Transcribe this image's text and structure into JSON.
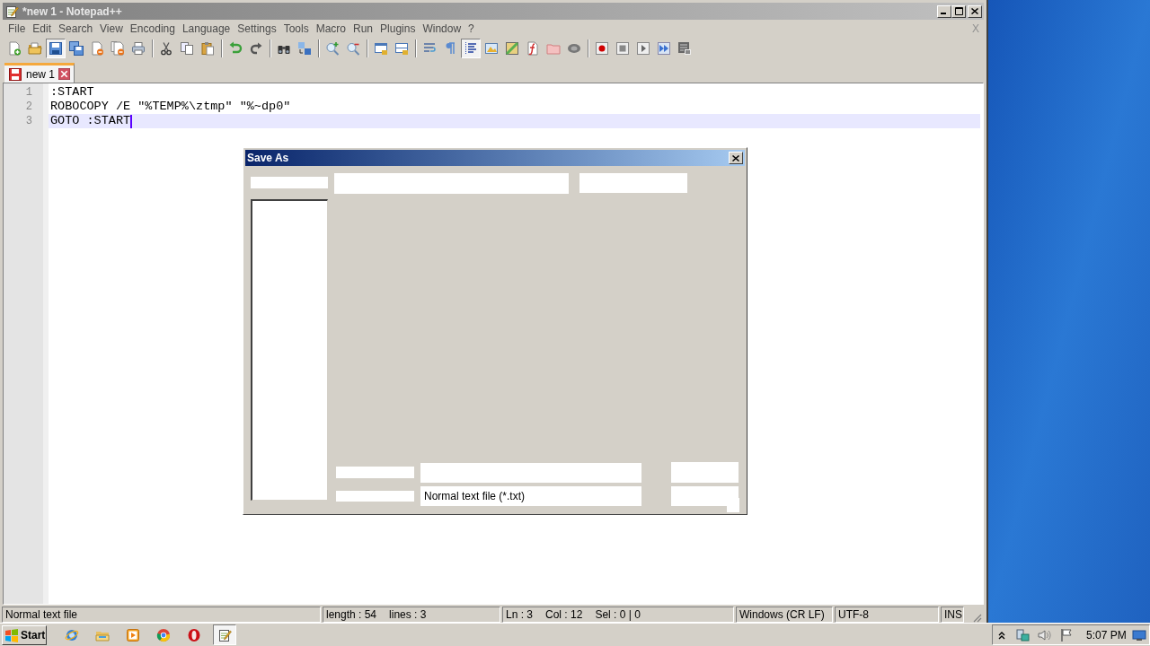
{
  "window": {
    "title": "*new 1 - Notepad++"
  },
  "menu_bar": {
    "items": [
      "File",
      "Edit",
      "Search",
      "View",
      "Encoding",
      "Language",
      "Settings",
      "Tools",
      "Macro",
      "Run",
      "Plugins",
      "Window",
      "?"
    ],
    "close_glyph": "X"
  },
  "toolbar": {
    "groups": [
      [
        {
          "pressed": false
        },
        {
          "pressed": false
        },
        {
          "pressed": true
        },
        {
          "pressed": false
        },
        {
          "pressed": false
        },
        {
          "pressed": false
        },
        {
          "pressed": false
        }
      ],
      [
        {
          "pressed": false
        },
        {
          "pressed": false
        },
        {
          "pressed": false
        }
      ],
      [
        {
          "pressed": false
        },
        {
          "pressed": false
        }
      ],
      [
        {
          "pressed": false
        },
        {
          "pressed": false
        }
      ],
      [
        {
          "pressed": false
        },
        {
          "pressed": false
        }
      ],
      [
        {
          "pressed": false
        },
        {
          "pressed": false
        }
      ],
      [
        {
          "pressed": false
        },
        {
          "pressed": false
        },
        {
          "pressed": true
        },
        {
          "pressed": false
        },
        {
          "pressed": false
        },
        {
          "pressed": false
        },
        {
          "pressed": false
        },
        {
          "pressed": false
        }
      ],
      [
        {
          "pressed": false
        },
        {
          "pressed": false
        },
        {
          "pressed": false
        },
        {
          "pressed": false
        },
        {
          "pressed": false
        }
      ]
    ]
  },
  "tabs": [
    {
      "label": "new 1",
      "selected": true,
      "modified": true
    }
  ],
  "editor": {
    "lines": [
      {
        "number": "1",
        "text": ":START",
        "current": false
      },
      {
        "number": "2",
        "text": "ROBOCOPY /E \"%TEMP%\\ztmp\" \"%~dp0\"",
        "current": false
      },
      {
        "number": "3",
        "text": "GOTO :START",
        "current": true
      }
    ]
  },
  "save_dialog": {
    "title": "Save As",
    "file_type_value": "Normal text file (*.txt)"
  },
  "status_bar": {
    "fields": [
      [
        "Normal text file"
      ],
      [
        "length : 54",
        "lines : 3"
      ],
      [
        "Ln : 3",
        "Col : 12",
        "Sel : 0 | 0"
      ],
      [
        "Windows (CR LF)"
      ],
      [
        "UTF-8"
      ],
      [
        "INS"
      ]
    ]
  },
  "taskbar": {
    "start_label": "Start",
    "apps": [
      {
        "active": false
      },
      {
        "active": false
      },
      {
        "active": false
      },
      {
        "active": false
      },
      {
        "active": false
      },
      {
        "active": true
      }
    ],
    "clock": "5:07 PM"
  }
}
